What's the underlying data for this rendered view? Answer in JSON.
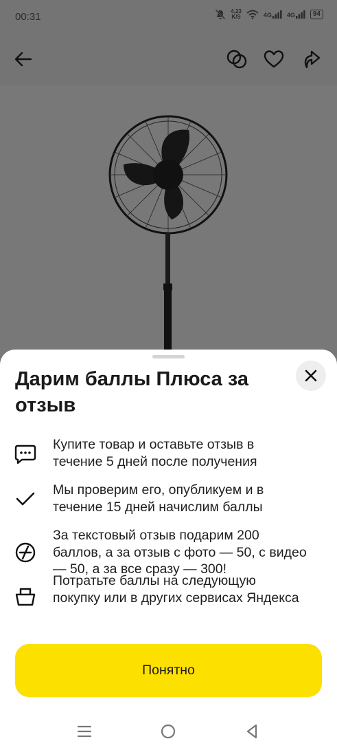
{
  "status_bar": {
    "time": "00:31",
    "net_speed_value": "4,23",
    "net_speed_unit": "K/S",
    "sim1": "4G",
    "sim2": "4G",
    "battery": "94"
  },
  "top_bar": {
    "icons": [
      "back-arrow-icon",
      "compare-icon",
      "heart-icon",
      "share-icon"
    ]
  },
  "sheet": {
    "title": "Дарим баллы Плюса за отзыв",
    "steps": [
      {
        "icon": "chat-bubble-icon",
        "text": "Купите товар и оставьте отзыв в течение 5 дней после получения"
      },
      {
        "icon": "check-icon",
        "text": "Мы проверим его, опубликуем и в течение 15 дней начислим баллы"
      },
      {
        "icon": "plus-points-icon",
        "text": "За текстовый отзыв подарим 200 баллов, а за отзыв с фото — 50, с видео — 50, а за все сразу — 300!"
      },
      {
        "icon": "basket-icon",
        "text": "Потратьте баллы на следующую покупку или в других сервисах Яндекса"
      }
    ],
    "button_label": "Понятно"
  },
  "nav_bar": {
    "icons": [
      "menu-icon",
      "home-icon",
      "back-icon"
    ]
  },
  "colors": {
    "accent": "#fce000",
    "overlay": "#7a7a7a",
    "sheet": "#ffffff"
  }
}
